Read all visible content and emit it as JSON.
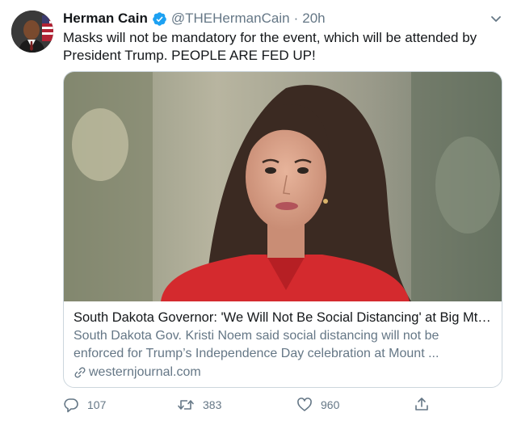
{
  "author": {
    "display_name": "Herman Cain",
    "handle": "@THEHermanCain",
    "separator": "·",
    "time": "20h",
    "avatar_icon": "person-portrait"
  },
  "tweet": {
    "text": "Masks will not be mandatory for the event, which will be attended by\nPresident Trump.  PEOPLE ARE FED UP!"
  },
  "card": {
    "title": "South Dakota Governor: 'We Will Not Be Social Distancing' at Big Mt. ...",
    "description": "South Dakota Gov. Kristi Noem said social distancing will not be\nenforced for Trump’s Independence Day celebration at Mount ...",
    "domain": "westernjournal.com"
  },
  "actions": {
    "replies": "107",
    "retweets": "383",
    "likes": "960"
  },
  "colors": {
    "verified": "#1da1f2",
    "secondary_text": "#657786",
    "border": "#ccd6dd"
  }
}
